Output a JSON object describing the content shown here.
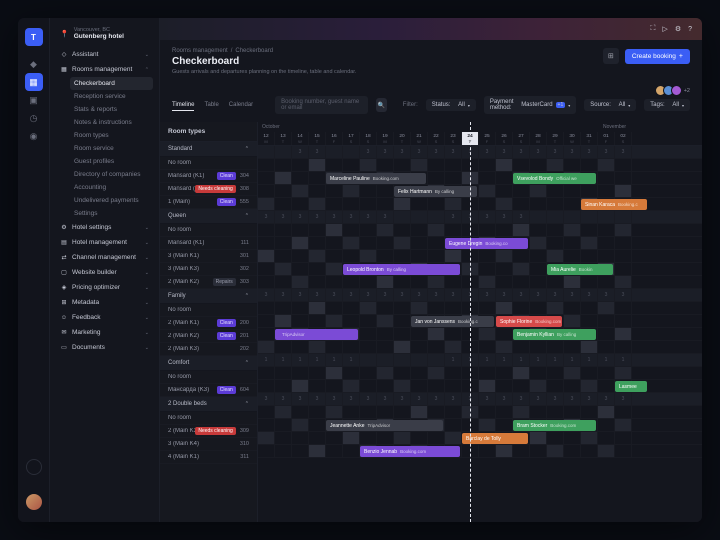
{
  "location": {
    "city": "Vancouver, BC",
    "hotel": "Gutenberg hotel"
  },
  "rail": [
    {
      "name": "home",
      "glyph": "◆"
    },
    {
      "name": "apps",
      "glyph": "▦",
      "active": true
    },
    {
      "name": "folder",
      "glyph": "▣"
    },
    {
      "name": "clock",
      "glyph": "◷"
    },
    {
      "name": "globe",
      "glyph": "◉"
    }
  ],
  "nav": {
    "assistant": "Assistant",
    "rooms": "Rooms management",
    "rooms_sub": [
      "Checkerboard",
      "Reception service",
      "Stats & reports",
      "Notes & instructions",
      "Room types",
      "Room service",
      "Guest profiles",
      "Directory of companies",
      "Accounting",
      "Undelivered payments",
      "Settings"
    ],
    "rest": [
      {
        "ico": "⚙",
        "label": "Hotel settings"
      },
      {
        "ico": "▤",
        "label": "Hotel management"
      },
      {
        "ico": "⇄",
        "label": "Channel management"
      },
      {
        "ico": "▢",
        "label": "Website builder"
      },
      {
        "ico": "◈",
        "label": "Pricing optimizer"
      },
      {
        "ico": "⊞",
        "label": "Metadata"
      },
      {
        "ico": "☺",
        "label": "Feedback"
      },
      {
        "ico": "✉",
        "label": "Marketing"
      },
      {
        "ico": "▭",
        "label": "Documents"
      }
    ]
  },
  "breadcrumb": {
    "a": "Rooms management",
    "b": "Checkerboard"
  },
  "page": {
    "title": "Checkerboard",
    "subtitle": "Guests arrivals and departures planning on the timeline, table and calendar.",
    "create": "Create booking"
  },
  "avatars_more": "+2",
  "tabs": [
    "Timeline",
    "Table",
    "Calendar"
  ],
  "search_placeholder": "Booking number, guest name or email",
  "filters": {
    "label": "Filter:",
    "status": {
      "label": "Status:",
      "value": "All"
    },
    "payment": {
      "label": "Payment method:",
      "value": "MasterCard",
      "badge": "+1"
    },
    "source": {
      "label": "Source:",
      "value": "All"
    },
    "tags": {
      "label": "Tags:",
      "value": "All"
    }
  },
  "room_head": "Room types",
  "months": {
    "oct": "October",
    "nov": "November"
  },
  "dates": [
    {
      "d": "12",
      "w": "M"
    },
    {
      "d": "13",
      "w": "T"
    },
    {
      "d": "14",
      "w": "W"
    },
    {
      "d": "15",
      "w": "T"
    },
    {
      "d": "16",
      "w": "F"
    },
    {
      "d": "17",
      "w": "S"
    },
    {
      "d": "18",
      "w": "S"
    },
    {
      "d": "19",
      "w": "M"
    },
    {
      "d": "20",
      "w": "T"
    },
    {
      "d": "21",
      "w": "W"
    },
    {
      "d": "22",
      "w": "S"
    },
    {
      "d": "23",
      "w": "S"
    },
    {
      "d": "24",
      "w": "T",
      "today": true
    },
    {
      "d": "25",
      "w": "F"
    },
    {
      "d": "26",
      "w": "S"
    },
    {
      "d": "27",
      "w": "S"
    },
    {
      "d": "28",
      "w": "M"
    },
    {
      "d": "29",
      "w": "T"
    },
    {
      "d": "30",
      "w": "W"
    },
    {
      "d": "31",
      "w": "T"
    },
    {
      "d": "01",
      "w": "F"
    },
    {
      "d": "02",
      "w": "S"
    }
  ],
  "rows": [
    {
      "type": "group",
      "label": "Standard",
      "avail": [
        "",
        "",
        "3",
        "3",
        "",
        "",
        "3",
        "3",
        "3",
        "3",
        "3",
        "3",
        "3",
        "3",
        "3",
        "3",
        "3",
        "3",
        "3",
        "3",
        "3",
        "3"
      ]
    },
    {
      "type": "room",
      "label": "No room",
      "bookings": []
    },
    {
      "type": "room",
      "label": "Mansard (K1)",
      "tag": "Clean",
      "tagcls": "clean",
      "num": "304",
      "bookings": [
        {
          "name": "Marceline Pauline",
          "src": "Booking.com",
          "cls": "bk-gray",
          "start": 4,
          "len": 6
        },
        {
          "name": "Vsevolod Bondy",
          "src": "Official we",
          "cls": "bk-green",
          "start": 15,
          "len": 5
        }
      ]
    },
    {
      "type": "room",
      "label": "Mansard (K2)",
      "tag": "Needs cleaning",
      "tagcls": "needs",
      "num": "308",
      "bookings": [
        {
          "name": "Felix Hartmann",
          "src": "By calling",
          "cls": "bk-gray",
          "start": 8,
          "len": 5
        }
      ]
    },
    {
      "type": "room",
      "label": "1 (Main)",
      "tag": "Clean",
      "tagcls": "clean",
      "num": "555",
      "bookings": [
        {
          "name": "Sinan Karaca",
          "src": "Booking.c",
          "cls": "bk-orange",
          "start": 19,
          "len": 4
        }
      ]
    },
    {
      "type": "group",
      "label": "Queen",
      "avail": [
        "3",
        "3",
        "3",
        "3",
        "3",
        "3",
        "3",
        "3",
        "",
        "",
        "",
        "3",
        "3",
        "3",
        "3",
        "3",
        "",
        "",
        "",
        "",
        "",
        ""
      ]
    },
    {
      "type": "room",
      "label": "No room",
      "bookings": []
    },
    {
      "type": "room",
      "label": "Mansard (K1)",
      "num": "111",
      "bookings": [
        {
          "name": "Eugene Dregin",
          "src": "Booking.co",
          "cls": "bk-purple",
          "start": 11,
          "len": 5
        }
      ]
    },
    {
      "type": "room",
      "label": "3 (Main K1)",
      "num": "301",
      "bookings": []
    },
    {
      "type": "room",
      "label": "3 (Main K3)",
      "num": "302",
      "bookings": [
        {
          "name": "Leopold Bronton",
          "src": "By calling",
          "cls": "bk-purple",
          "start": 5,
          "len": 7
        },
        {
          "name": "Mia Aurelie",
          "src": "Bookin",
          "cls": "bk-green",
          "start": 17,
          "len": 4
        }
      ]
    },
    {
      "type": "room",
      "label": "2 (Main K2)",
      "tag": "Repairs",
      "tagcls": "repairs",
      "num": "303",
      "bookings": []
    },
    {
      "type": "group",
      "label": "Family",
      "avail": [
        "3",
        "3",
        "3",
        "3",
        "3",
        "3",
        "3",
        "3",
        "3",
        "3",
        "3",
        "3",
        "3",
        "3",
        "3",
        "3",
        "3",
        "3",
        "3",
        "3",
        "3",
        "3"
      ]
    },
    {
      "type": "room",
      "label": "No room",
      "bookings": []
    },
    {
      "type": "room",
      "label": "2 (Main K1)",
      "tag": "Clean",
      "tagcls": "clean",
      "num": "200",
      "bookings": [
        {
          "name": "Jan von Janssens",
          "src": "Booking.c",
          "cls": "bk-gray",
          "start": 9,
          "len": 5
        },
        {
          "name": "Sophie Florine",
          "src": "Booking.com",
          "cls": "bk-red",
          "start": 14,
          "len": 4
        }
      ]
    },
    {
      "type": "room",
      "label": "2 (Main K2)",
      "tag": "Clean",
      "tagcls": "clean",
      "num": "201",
      "bookings": [
        {
          "name": "",
          "src": "TripAdvisor",
          "cls": "bk-purple",
          "start": 1,
          "len": 5
        },
        {
          "name": "Benjamin Kyllian",
          "src": "By calling",
          "cls": "bk-green",
          "start": 15,
          "len": 5
        }
      ]
    },
    {
      "type": "room",
      "label": "2 (Main K3)",
      "num": "202",
      "bookings": []
    },
    {
      "type": "group",
      "label": "Comfort",
      "avail": [
        "1",
        "1",
        "1",
        "1",
        "1",
        "1",
        "",
        "",
        "",
        "",
        "",
        "1",
        "1",
        "1",
        "1",
        "1",
        "1",
        "1",
        "1",
        "1",
        "1",
        "1"
      ]
    },
    {
      "type": "room",
      "label": "No room",
      "bookings": []
    },
    {
      "type": "room",
      "label": "Мансарда (K3)",
      "tag": "Clean",
      "tagcls": "clean",
      "num": "604",
      "bookings": [
        {
          "name": "Lasmee",
          "src": "",
          "cls": "bk-green",
          "start": 21,
          "len": 2
        }
      ]
    },
    {
      "type": "group",
      "label": "2 Double beds",
      "avail": [
        "3",
        "3",
        "3",
        "3",
        "3",
        "3",
        "3",
        "3",
        "3",
        "3",
        "3",
        "3",
        "3",
        "3",
        "3",
        "3",
        "3",
        "3",
        "3",
        "3",
        "3",
        "3"
      ]
    },
    {
      "type": "room",
      "label": "No room",
      "bookings": []
    },
    {
      "type": "room",
      "label": "2 (Main K3)",
      "tag": "Needs cleaning",
      "tagcls": "needs",
      "num": "309",
      "bookings": [
        {
          "name": "Jeannette Anke",
          "src": "TripAdvisor",
          "cls": "bk-gray",
          "start": 4,
          "len": 7
        },
        {
          "name": "Bram Stocker",
          "src": "Booking.com",
          "cls": "bk-green",
          "start": 15,
          "len": 5
        }
      ]
    },
    {
      "type": "room",
      "label": "3 (Main K4)",
      "num": "310",
      "bookings": [
        {
          "name": "Barclay de Tolly",
          "src": "",
          "cls": "bk-orange",
          "start": 12,
          "len": 4
        }
      ]
    },
    {
      "type": "room",
      "label": "4 (Main K1)",
      "num": "311",
      "bookings": [
        {
          "name": "Benzio Jennab",
          "src": "Booking.com",
          "cls": "bk-purple",
          "start": 6,
          "len": 6
        }
      ]
    }
  ]
}
